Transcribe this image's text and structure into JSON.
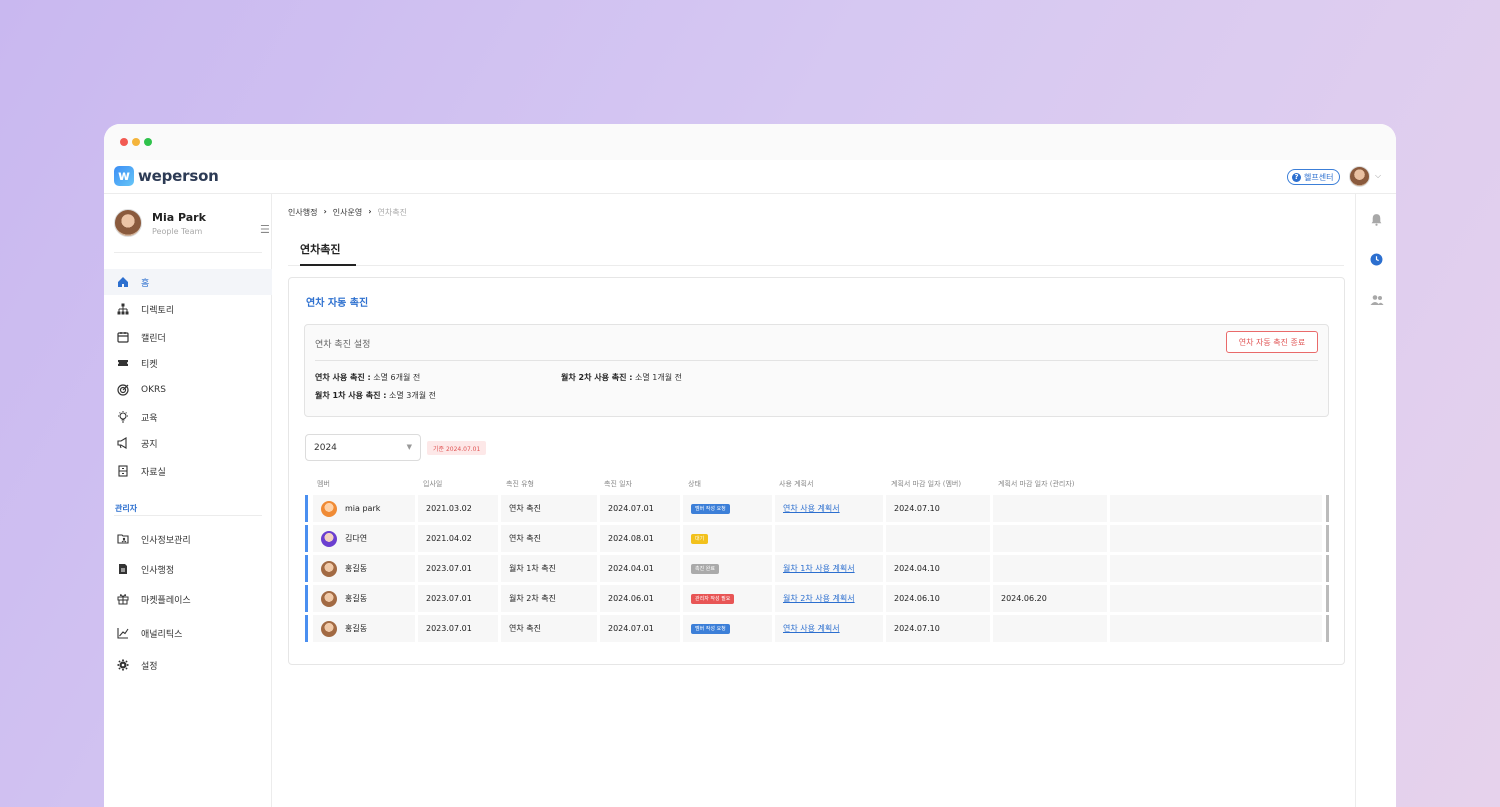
{
  "app": {
    "logo_text": "weperson",
    "help_label": "헬프센터"
  },
  "profile": {
    "name": "Mia Park",
    "team": "People Team"
  },
  "nav": {
    "items": [
      {
        "label": "홈",
        "icon": "home-icon"
      },
      {
        "label": "디렉토리",
        "icon": "org-chart-icon"
      },
      {
        "label": "캘린더",
        "icon": "calendar-icon"
      },
      {
        "label": "티켓",
        "icon": "ticket-icon"
      },
      {
        "label": "OKRS",
        "icon": "target-icon"
      },
      {
        "label": "교육",
        "icon": "lightbulb-icon"
      },
      {
        "label": "공지",
        "icon": "megaphone-icon"
      },
      {
        "label": "자료실",
        "icon": "archive-icon"
      }
    ],
    "admin_label": "관리자",
    "admin_items": [
      {
        "label": "인사정보관리",
        "icon": "folder-user-icon"
      },
      {
        "label": "인사행정",
        "icon": "document-icon"
      },
      {
        "label": "마켓플레이스",
        "icon": "gift-icon"
      },
      {
        "label": "애널리틱스",
        "icon": "line-chart-icon"
      },
      {
        "label": "설정",
        "icon": "gear-icon"
      }
    ]
  },
  "breadcrumb": {
    "level1": "인사행정",
    "level2": "인사운영",
    "current": "연차촉진"
  },
  "page": {
    "tab_title": "연차촉진",
    "card_title": "연차 자동 촉진"
  },
  "settings": {
    "title": "연차 촉진 설정",
    "stop_button": "연차 자동 촉진 종료",
    "rule1_label": "연차 사용 촉진 :",
    "rule1_value": "소멸 6개월 전",
    "rule2_label": "월차 2차 사용 촉진 :",
    "rule2_value": "소멸 1개월 전",
    "rule3_label": "월차 1차 사용 촉진 :",
    "rule3_value": "소멸 3개월 전"
  },
  "filter": {
    "year": "2024",
    "ref_badge": "기준 2024.07.01"
  },
  "table": {
    "headers": [
      "멤버",
      "입사일",
      "촉진 유형",
      "촉진 일자",
      "상태",
      "사용 계획서",
      "계획서 마감 일자 (멤버)",
      "계획서 마감 일자 (관리자)"
    ],
    "rows": [
      {
        "member": "mia park",
        "join": "2021.03.02",
        "type": "연차 촉진",
        "date": "2024.07.01",
        "status": "멤버 작성 요청",
        "plan": "연차 사용 계획서",
        "member_due": "2024.07.10",
        "admin_due": ""
      },
      {
        "member": "김다연",
        "join": "2021.04.02",
        "type": "연차 촉진",
        "date": "2024.08.01",
        "status": "대기",
        "plan": "",
        "member_due": "",
        "admin_due": ""
      },
      {
        "member": "홍길동",
        "join": "2023.07.01",
        "type": "월차 1차 촉진",
        "date": "2024.04.01",
        "status": "촉진 완료",
        "plan": "월차 1차 사용 계획서",
        "member_due": "2024.04.10",
        "admin_due": ""
      },
      {
        "member": "홍길동",
        "join": "2023.07.01",
        "type": "월차 2차 촉진",
        "date": "2024.06.01",
        "status": "관리자 작성 필요",
        "plan": "월차 2차 사용 계획서",
        "member_due": "2024.06.10",
        "admin_due": "2024.06.20"
      },
      {
        "member": "홍길동",
        "join": "2023.07.01",
        "type": "연차 촉진",
        "date": "2024.07.01",
        "status": "멤버 작성 요청",
        "plan": "연차 사용 계획서",
        "member_due": "2024.07.10",
        "admin_due": ""
      }
    ]
  },
  "colors": {
    "accent": "#2c6fcf",
    "danger": "#e05555",
    "row_bar": "#4a8ff0"
  }
}
